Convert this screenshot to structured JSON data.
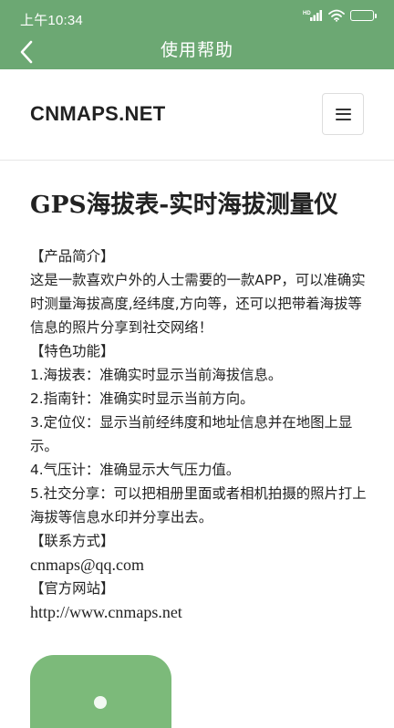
{
  "status_bar": {
    "time": "上午10:34",
    "battery_level": "99",
    "battery_fraction": 0.99,
    "signal_icon": "cell-signal-hd-icon",
    "wifi_icon": "wifi-icon"
  },
  "app_bar": {
    "title": "使用帮助",
    "back_icon": "chevron-left-icon",
    "color": "#6ca873"
  },
  "site": {
    "logo": "CNMAPS.NET",
    "menu_icon": "hamburger-menu-icon"
  },
  "article": {
    "title": "GPS海拔表-实时海拔测量仪",
    "paragraphs": [
      "【产品简介】",
      "这是一款喜欢户外的人士需要的一款APP，可以准确实时测量海拔高度,经纬度,方向等，还可以把带着海拔等信息的照片分享到社交网络！",
      "【特色功能】",
      "1.海拔表：准确实时显示当前海拔信息。",
      "2.指南针：准确实时显示当前方向。",
      "3.定位仪：显示当前经纬度和地址信息并在地图上显示。",
      "4.气压计：准确显示大气压力值。",
      "5.社交分享：可以把相册里面或者相机拍摄的照片打上海拔等信息水印并分享出去。",
      "【联系方式】",
      "cnmaps@qq.com",
      "【官方网站】",
      "http://www.cnmaps.net"
    ]
  },
  "app_icon": {
    "color": "#7cba7a"
  }
}
